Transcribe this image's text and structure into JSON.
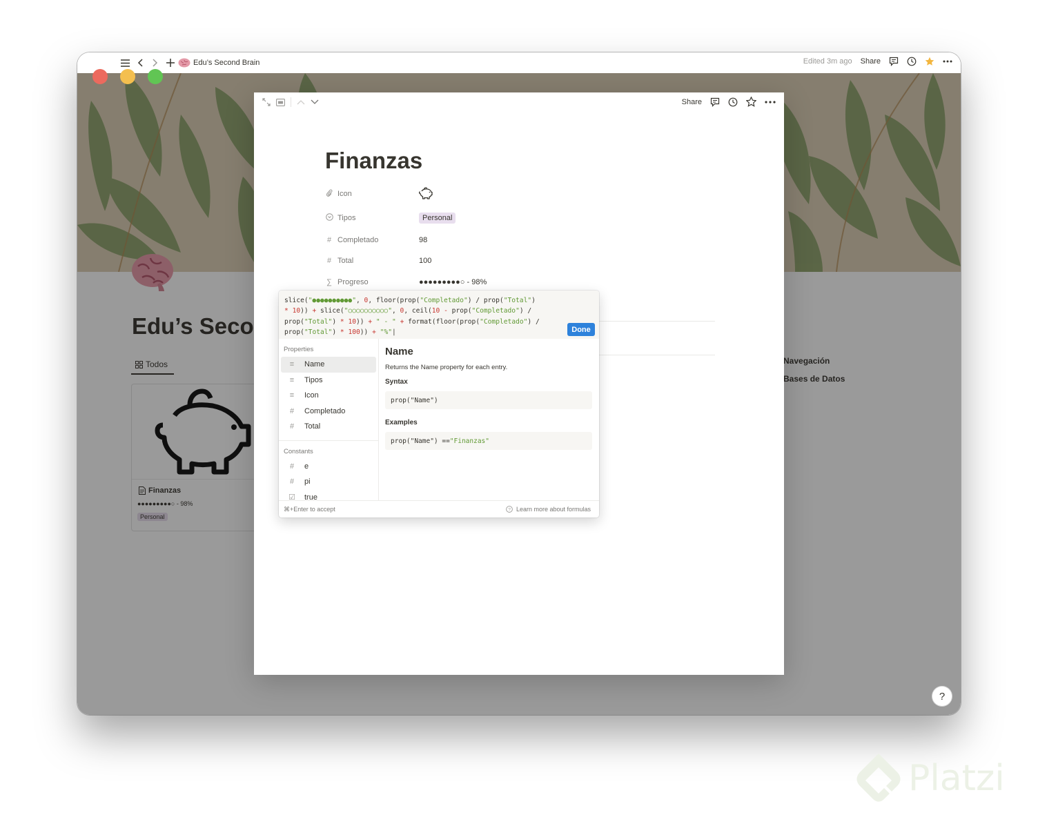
{
  "topbar": {
    "breadcrumb": "Edu’s Second Brain",
    "edited": "Edited 3m ago",
    "share": "Share"
  },
  "background_page": {
    "title": "Edu’s Seco",
    "tab": "Todos",
    "card": {
      "title": "Finanzas",
      "progress": "●●●●●●●●●○ - 98%",
      "tag": "Personal"
    },
    "side_links": [
      "Navegación",
      "Bases de Datos"
    ],
    "help": "?"
  },
  "modal": {
    "share": "Share",
    "title": "Finanzas",
    "properties": [
      {
        "name": "Icon",
        "icon": "paperclip-icon",
        "value": ""
      },
      {
        "name": "Tipos",
        "icon": "select-icon",
        "value": "Personal"
      },
      {
        "name": "Completado",
        "icon": "number-icon",
        "value": "98"
      },
      {
        "name": "Total",
        "icon": "number-icon",
        "value": "100"
      },
      {
        "name": "Progreso",
        "icon": "formula-icon",
        "value": "●●●●●●●●●○ - 98%"
      }
    ]
  },
  "formula": {
    "done": "Done",
    "properties_label": "Properties",
    "properties": [
      "Name",
      "Tipos",
      "Icon",
      "Completado",
      "Total"
    ],
    "constants_label": "Constants",
    "constants": [
      "e",
      "pi",
      "true"
    ],
    "detail": {
      "title": "Name",
      "description": "Returns the Name property for each entry.",
      "syntax_label": "Syntax",
      "syntax": "prop(\"Name\")",
      "examples_label": "Examples",
      "example_prefix": "prop(\"Name\") == ",
      "example_value": "\"Finanzas\""
    },
    "footer_left": "⌘+Enter to accept",
    "footer_right": "Learn more about formulas"
  },
  "watermark": "Platzi",
  "colors": {
    "accent": "#2e82db",
    "tag_bg": "#e8deee",
    "code_string": "#629a36",
    "code_number": "#c7362f"
  }
}
